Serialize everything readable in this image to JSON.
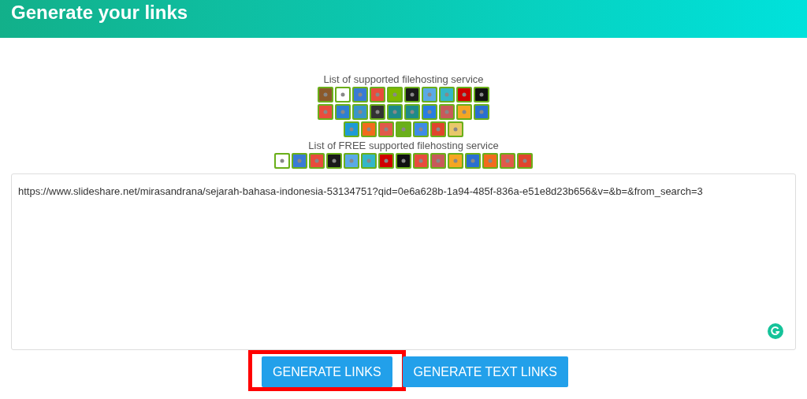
{
  "header": {
    "title": "Generate your links"
  },
  "supported": {
    "title": "List of supported filehosting service",
    "rows": [
      [
        {
          "color": "#8b5a2b"
        },
        {
          "color": "#ffffff"
        },
        {
          "color": "#3a7bd5"
        },
        {
          "color": "#e84c3d"
        },
        {
          "color": "#7fb800"
        },
        {
          "color": "#1a1a1a"
        },
        {
          "color": "#5aa9e6"
        },
        {
          "color": "#34b6c8"
        },
        {
          "color": "#d00000"
        },
        {
          "color": "#111111"
        }
      ],
      [
        {
          "color": "#e84c3d"
        },
        {
          "color": "#2f7fd1"
        },
        {
          "color": "#3a95c8"
        },
        {
          "color": "#333333"
        },
        {
          "color": "#1f8a8a"
        },
        {
          "color": "#1f8a8a"
        },
        {
          "color": "#2a7de1"
        },
        {
          "color": "#c85a5a"
        },
        {
          "color": "#f5a623"
        },
        {
          "color": "#2a6fd1"
        }
      ],
      [
        {
          "color": "#1e9ad6"
        },
        {
          "color": "#f26b1d"
        },
        {
          "color": "#e05a4a"
        },
        {
          "color": "#6aaf1a"
        },
        {
          "color": "#3d8be6"
        },
        {
          "color": "#e0452c"
        },
        {
          "color": "#e8c86a"
        }
      ]
    ]
  },
  "free": {
    "title": "List of FREE supported filehosting service",
    "rows": [
      [
        {
          "color": "#ffffff"
        },
        {
          "color": "#3a7bd5"
        },
        {
          "color": "#e84c3d"
        },
        {
          "color": "#1a1a1a"
        },
        {
          "color": "#5aa9e6"
        },
        {
          "color": "#34b6c8"
        },
        {
          "color": "#d00000"
        },
        {
          "color": "#111111"
        },
        {
          "color": "#e84c3d"
        },
        {
          "color": "#c85a5a"
        },
        {
          "color": "#f5a623"
        },
        {
          "color": "#2a6fd1"
        },
        {
          "color": "#f26b1d"
        },
        {
          "color": "#e05a4a"
        },
        {
          "color": "#e0452c"
        }
      ]
    ]
  },
  "links_field": {
    "value": "https://www.slideshare.net/mirasandrana/sejarah-bahasa-indonesia-53134751?qid=0e6a628b-1a94-485f-836a-e51e8d23b656&v=&b=&from_search=3"
  },
  "buttons": [
    {
      "label": "GENERATE LINKS",
      "highlighted": true
    },
    {
      "label": "GENERATE TEXT LINKS",
      "highlighted": false
    }
  ]
}
